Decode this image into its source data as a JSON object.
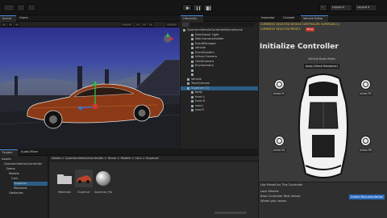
{
  "toolbar": {
    "left_menus": [
      "",
      "",
      ""
    ],
    "right_controls": [
      "",
      "Layers",
      "Layout"
    ],
    "colors": {
      "background": "#151515",
      "play_icon": "#bdbdbd"
    }
  },
  "scene": {
    "tabs": [
      "Scene",
      "Game"
    ],
    "colors": {
      "sky_top": "#2d2f8a",
      "sky_mid": "#55648f",
      "ground": "#2c2f3c",
      "car_body": "#8a3a16",
      "gizmo_y": "#2ec24a",
      "gizmo_x": "#d33"
    }
  },
  "hierarchy": {
    "tab": "Hierarchy",
    "items": [
      {
        "label": "QuantumVehicleControllerDemoScene",
        "indent": 0,
        "selected": false
      },
      {
        "label": "Directional Light",
        "indent": 2,
        "selected": false
      },
      {
        "label": "MainCamera/Holder",
        "indent": 2,
        "selected": false
      },
      {
        "label": "EventManager",
        "indent": 2,
        "selected": false
      },
      {
        "label": "Vehicle",
        "indent": 2,
        "selected": false
      },
      {
        "label": "EventSystem",
        "indent": 2,
        "selected": false
      },
      {
        "label": "Virtual Camera",
        "indent": 2,
        "selected": false
      },
      {
        "label": "OrbitCamera",
        "indent": 2,
        "selected": false
      },
      {
        "label": "Environment",
        "indent": 2,
        "selected": false
      },
      {
        "label": "",
        "indent": 2,
        "selected": false
      },
      {
        "label": "",
        "indent": 2,
        "selected": false
      },
      {
        "label": "Vehicle",
        "indent": 1,
        "selected": false
      },
      {
        "label": "TrackCanvas",
        "indent": 1,
        "selected": false
      },
      {
        "label": "Supercar (1)",
        "indent": 1,
        "selected": true
      },
      {
        "label": "body",
        "indent": 2,
        "selected": false
      },
      {
        "label": "front-L",
        "indent": 2,
        "selected": false
      },
      {
        "label": "front-R",
        "indent": 2,
        "selected": false
      },
      {
        "label": "rear-L",
        "indent": 2,
        "selected": false
      },
      {
        "label": "rear-R",
        "indent": 2,
        "selected": false
      }
    ]
  },
  "inspector": {
    "tabs": [
      "Inspector",
      "Console",
      "Vehicle Editor"
    ],
    "header_line1": "CURRENTLY SELECTED VEHICLE CONTROLLER: SUPERCAR (1)",
    "header_line2": "CURRENTLY SELECTED PRESET:",
    "preset_badge": "None",
    "title": "Initialize Controller",
    "body_label": "Vehicle Body Mesh",
    "body_select": "body (Mesh Renderer)",
    "wheels": [
      "wheel-FL",
      "wheel-FR",
      "wheel-RL",
      "wheel-RR"
    ],
    "footer_rows": [
      "Use Preset for This Controller",
      "Lock Wheels",
      "Base Controller Rest Values",
      "Wheel grip values"
    ],
    "doc_button": "Online Documentation",
    "colors": {
      "panel": "#3a3a3a",
      "header_yellow": "#e7c23c",
      "badge_red": "#c0392b",
      "doc_button": "#2d6ec0"
    }
  },
  "project": {
    "tabs": [
      "Project",
      "Audio Mixer"
    ],
    "tree": [
      "Assets",
      "QuantumVehicleController",
      "Demo",
      "Models",
      "Cars",
      "Supercar",
      "Materials",
      "Obstacles"
    ],
    "breadcrumb": "Assets > QuantumVehicleController > Demo > Models > Cars > Supercar",
    "assets": [
      {
        "label": "Materials",
        "icon": "folder-icon"
      },
      {
        "label": "Supercar",
        "icon": "car-model-icon"
      },
      {
        "label": "Supercar_Mat",
        "icon": "material-sphere-icon"
      }
    ]
  }
}
